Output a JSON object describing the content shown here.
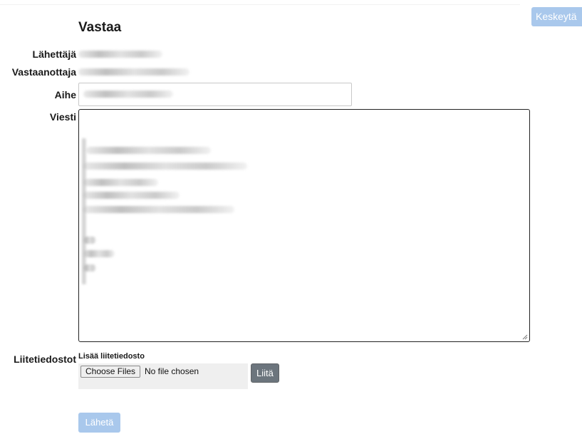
{
  "header": {
    "title": "Vastaa",
    "cancel_label": "Keskeytä"
  },
  "form": {
    "sender_label": "Lähettäjä",
    "recipient_label": "Vastaanottaja",
    "subject_label": "Aihe",
    "message_label": "Viesti",
    "attachments_label": "Liitetiedostot"
  },
  "attachments": {
    "add_label": "Lisää liitetiedosto",
    "choose_files_label": "Choose Files",
    "no_file_text": "No file chosen",
    "attach_button_label": "Liitä"
  },
  "footer": {
    "send_label": "Lähetä"
  },
  "colors": {
    "primary_disabled": "#a9c8ec",
    "secondary": "#6c757d"
  }
}
